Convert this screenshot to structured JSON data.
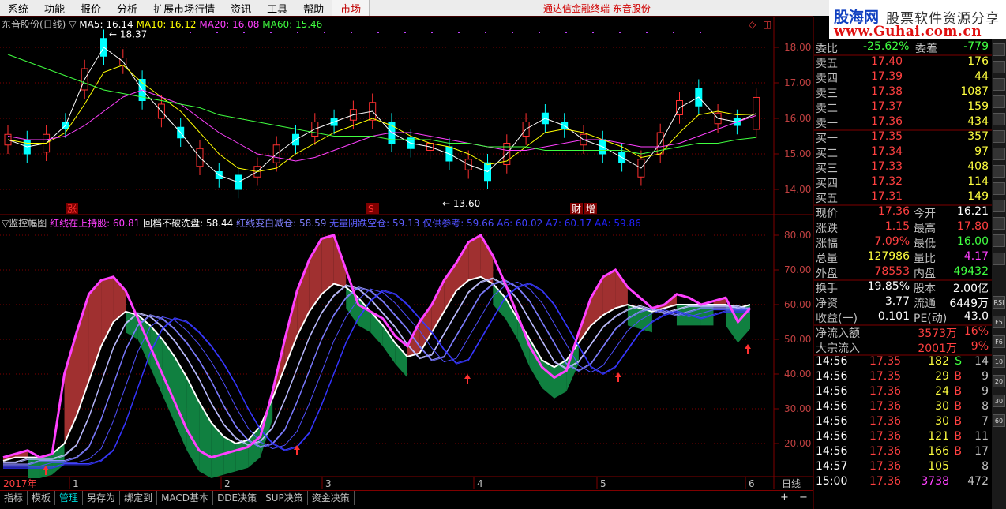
{
  "menu": {
    "items": [
      "系统",
      "功能",
      "报价",
      "分析",
      "扩展市场行情",
      "资讯",
      "工具",
      "帮助"
    ],
    "market": "市场",
    "title": "通达信金融终端  东音股份"
  },
  "logo": {
    "l1": "股海网",
    "l1b": "股票软件资源分享",
    "l2": "www.Guhai.com.cn"
  },
  "chart": {
    "name": "东音股份(日线)",
    "ma5": "MA5: 16.14",
    "ma10": "MA10: 16.12",
    "ma20": "MA20: 16.08",
    "ma60": "MA60: 15.46",
    "high_label": "18.37",
    "low_label": "13.60",
    "y_ticks": [
      "18.00",
      "17.00",
      "16.00",
      "15.00",
      "14.00"
    ],
    "markers": {
      "zhang": "涨",
      "s": "S",
      "cai": "财",
      "zeng": "增"
    }
  },
  "indicator": {
    "name": "▽监控幅图",
    "items": [
      {
        "label": "红线在上持股:",
        "value": "60.81",
        "color": "#ff40ff"
      },
      {
        "label": "回档不破洗盘:",
        "value": "58.44",
        "color": "#ffffff"
      },
      {
        "label": "红线变白减仓:",
        "value": "58.59",
        "color": "#8080ff"
      },
      {
        "label": "无量阴跌空仓:",
        "value": "59.13",
        "color": "#6060ff"
      },
      {
        "label": "仅供参考:",
        "value": "59.66",
        "color": "#5050ff"
      },
      {
        "label": "A6:",
        "value": "60.02",
        "color": "#4040ff"
      },
      {
        "label": "A7:",
        "value": "60.17",
        "color": "#3030ff"
      },
      {
        "label": "AA:",
        "value": "59.86",
        "color": "#2020ff"
      }
    ],
    "y_ticks": [
      "80.00",
      "70.00",
      "60.00",
      "50.00",
      "40.00",
      "30.00",
      "20.00"
    ]
  },
  "timeline": {
    "year": "2017年",
    "months": [
      "1",
      "2",
      "3",
      "4",
      "5",
      "6"
    ],
    "period": "日线"
  },
  "quote": {
    "weibi": {
      "label": "委比",
      "value": "-25.62%",
      "label2": "委差",
      "value2": "-779"
    },
    "sell": [
      {
        "label": "卖五",
        "price": "17.40",
        "vol": "176"
      },
      {
        "label": "卖四",
        "price": "17.39",
        "vol": "44"
      },
      {
        "label": "卖三",
        "price": "17.38",
        "vol": "1087"
      },
      {
        "label": "卖二",
        "price": "17.37",
        "vol": "159"
      },
      {
        "label": "卖一",
        "price": "17.36",
        "vol": "434"
      }
    ],
    "buy": [
      {
        "label": "买一",
        "price": "17.35",
        "vol": "357"
      },
      {
        "label": "买二",
        "price": "17.34",
        "vol": "97"
      },
      {
        "label": "买三",
        "price": "17.33",
        "vol": "408"
      },
      {
        "label": "买四",
        "price": "17.32",
        "vol": "114"
      },
      {
        "label": "买五",
        "price": "17.31",
        "vol": "149"
      }
    ],
    "stats": [
      {
        "l1": "现价",
        "v1": "17.36",
        "l2": "今开",
        "v2": "16.21",
        "c1": "#ff4040",
        "c2": "#ffffff"
      },
      {
        "l1": "涨跌",
        "v1": "1.15",
        "l2": "最高",
        "v2": "17.80",
        "c1": "#ff4040",
        "c2": "#ff4040"
      },
      {
        "l1": "涨幅",
        "v1": "7.09%",
        "l2": "最低",
        "v2": "16.00",
        "c1": "#ff4040",
        "c2": "#40ff40"
      },
      {
        "l1": "总量",
        "v1": "127986",
        "l2": "量比",
        "v2": "4.17",
        "c1": "#ffff40",
        "c2": "#ff40ff"
      },
      {
        "l1": "外盘",
        "v1": "78553",
        "l2": "内盘",
        "v2": "49432",
        "c1": "#ff4040",
        "c2": "#40ff40"
      }
    ],
    "stats2": [
      {
        "l1": "换手",
        "v1": "19.85%",
        "l2": "股本",
        "v2": "2.00亿"
      },
      {
        "l1": "净资",
        "v1": "3.77",
        "l2": "流通",
        "v2": "6449万"
      },
      {
        "l1": "收益(一)",
        "v1": "0.101",
        "l2": "PE(动)",
        "v2": "43.0"
      }
    ],
    "flow": [
      {
        "label": "净流入额",
        "value": "3573万",
        "pct": "16%"
      },
      {
        "label": "大宗流入",
        "value": "2001万",
        "pct": "9%"
      }
    ],
    "ticks": [
      {
        "t": "14:56",
        "p": "17.35",
        "v": "182",
        "s": "S",
        "n": "14"
      },
      {
        "t": "14:56",
        "p": "17.35",
        "v": "29",
        "s": "B",
        "n": "9"
      },
      {
        "t": "14:56",
        "p": "17.36",
        "v": "24",
        "s": "B",
        "n": "9"
      },
      {
        "t": "14:56",
        "p": "17.36",
        "v": "30",
        "s": "B",
        "n": "8"
      },
      {
        "t": "14:56",
        "p": "17.36",
        "v": "30",
        "s": "B",
        "n": "7"
      },
      {
        "t": "14:56",
        "p": "17.36",
        "v": "121",
        "s": "B",
        "n": "11"
      },
      {
        "t": "14:56",
        "p": "17.36",
        "v": "166",
        "s": "B",
        "n": "17"
      },
      {
        "t": "14:57",
        "p": "17.36",
        "v": "105",
        "s": "",
        "n": "8"
      },
      {
        "t": "15:00",
        "p": "17.36",
        "v": "3738",
        "s": "",
        "n": "472"
      }
    ]
  },
  "tabs": [
    "指标",
    "模板",
    "管理",
    "另存为",
    "绑定到",
    "MACD基本",
    "DDE决策",
    "SUP决策",
    "资金决策"
  ],
  "zoom": {
    "plus": "+",
    "minus": "−"
  },
  "sidebar": [
    "RSI",
    "F5",
    "F6",
    "10",
    "20",
    "30",
    "60"
  ],
  "colors": {
    "up": "#ff3030",
    "down": "#00ffff",
    "ma5": "#ffffff",
    "ma10": "#ffff00",
    "ma20": "#ff40ff",
    "ma60": "#40ff40",
    "grid": "#800000"
  },
  "chart_data": {
    "type": "line",
    "title": "东音股份(日线)",
    "series": [
      {
        "name": "MA5",
        "values": [
          15.4,
          15.2,
          15.3,
          15.8,
          17.1,
          18.0,
          17.6,
          16.8,
          16.2,
          15.6,
          14.9,
          14.4,
          14.2,
          14.5,
          15.0,
          15.4,
          15.7,
          15.9,
          16.1,
          16.2,
          15.6,
          15.3,
          15.2,
          15.0,
          14.7,
          14.5,
          15.0,
          15.7,
          16.0,
          15.8,
          15.4,
          15.2,
          14.9,
          14.6,
          15.3,
          16.3,
          16.6,
          16.0,
          15.9,
          16.14
        ]
      },
      {
        "name": "MA10",
        "values": [
          15.4,
          15.3,
          15.3,
          15.6,
          16.4,
          17.3,
          17.5,
          17.0,
          16.6,
          16.2,
          15.6,
          15.0,
          14.6,
          14.5,
          14.6,
          15.0,
          15.3,
          15.6,
          15.8,
          16.0,
          15.8,
          15.5,
          15.3,
          15.2,
          15.0,
          14.7,
          14.8,
          15.2,
          15.6,
          15.7,
          15.6,
          15.4,
          15.2,
          14.9,
          15.0,
          15.6,
          16.1,
          16.2,
          16.1,
          16.12
        ]
      },
      {
        "name": "MA20",
        "values": [
          15.5,
          15.4,
          15.4,
          15.5,
          15.8,
          16.2,
          16.6,
          16.8,
          16.6,
          16.4,
          16.0,
          15.6,
          15.3,
          15.0,
          14.9,
          14.8,
          14.9,
          15.1,
          15.3,
          15.5,
          15.6,
          15.6,
          15.5,
          15.4,
          15.3,
          15.2,
          15.1,
          15.1,
          15.2,
          15.3,
          15.4,
          15.4,
          15.3,
          15.2,
          15.2,
          15.3,
          15.5,
          15.7,
          15.9,
          16.08
        ]
      },
      {
        "name": "MA60",
        "values": [
          17.8,
          17.6,
          17.4,
          17.2,
          17.0,
          16.8,
          16.7,
          16.6,
          16.5,
          16.4,
          16.3,
          16.1,
          16.0,
          15.9,
          15.8,
          15.7,
          15.6,
          15.5,
          15.5,
          15.5,
          15.4,
          15.4,
          15.4,
          15.3,
          15.3,
          15.2,
          15.2,
          15.2,
          15.1,
          15.1,
          15.1,
          15.1,
          15.1,
          15.0,
          15.1,
          15.2,
          15.3,
          15.3,
          15.4,
          15.46
        ]
      }
    ],
    "ylim": [
      13.5,
      18.5
    ]
  }
}
